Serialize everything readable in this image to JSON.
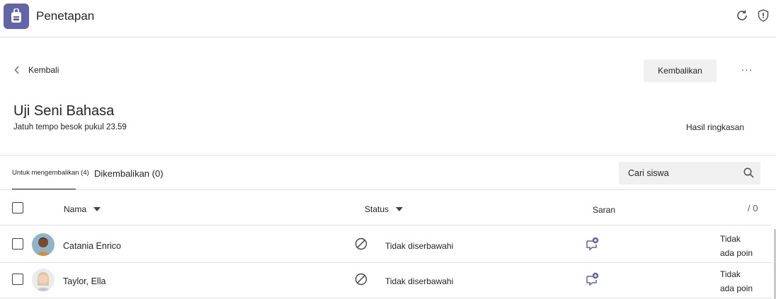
{
  "app": {
    "title": "Penetapan",
    "icon": "backpack-icon",
    "accent": "#6264a7"
  },
  "header": {
    "back_label": "Kembali",
    "return_label": "Kembalikan",
    "more_label": "···"
  },
  "assignment": {
    "title": "Uji Seni Bahasa",
    "due": "Jatuh tempo besok pukul 23.59",
    "summary_label": "Hasil ringkasan"
  },
  "tabs": [
    {
      "label": "Untuk mengembalikan (4)"
    },
    {
      "label": "Dikembalikan (0)"
    }
  ],
  "search": {
    "placeholder": "Cari siswa"
  },
  "table": {
    "columns": {
      "name": "Nama",
      "status": "Status",
      "feedback": "Saran",
      "points": "/ 0"
    },
    "rows": [
      {
        "name": "Catania Enrico",
        "status": "Tidak diserbawahi",
        "points_line1": "Tidak",
        "points_line2": "ada poin"
      },
      {
        "name": "Taylor, Ella",
        "status": "Tidak diserbawahi",
        "points_line1": "Tidak",
        "points_line2": "ada poin"
      }
    ]
  }
}
